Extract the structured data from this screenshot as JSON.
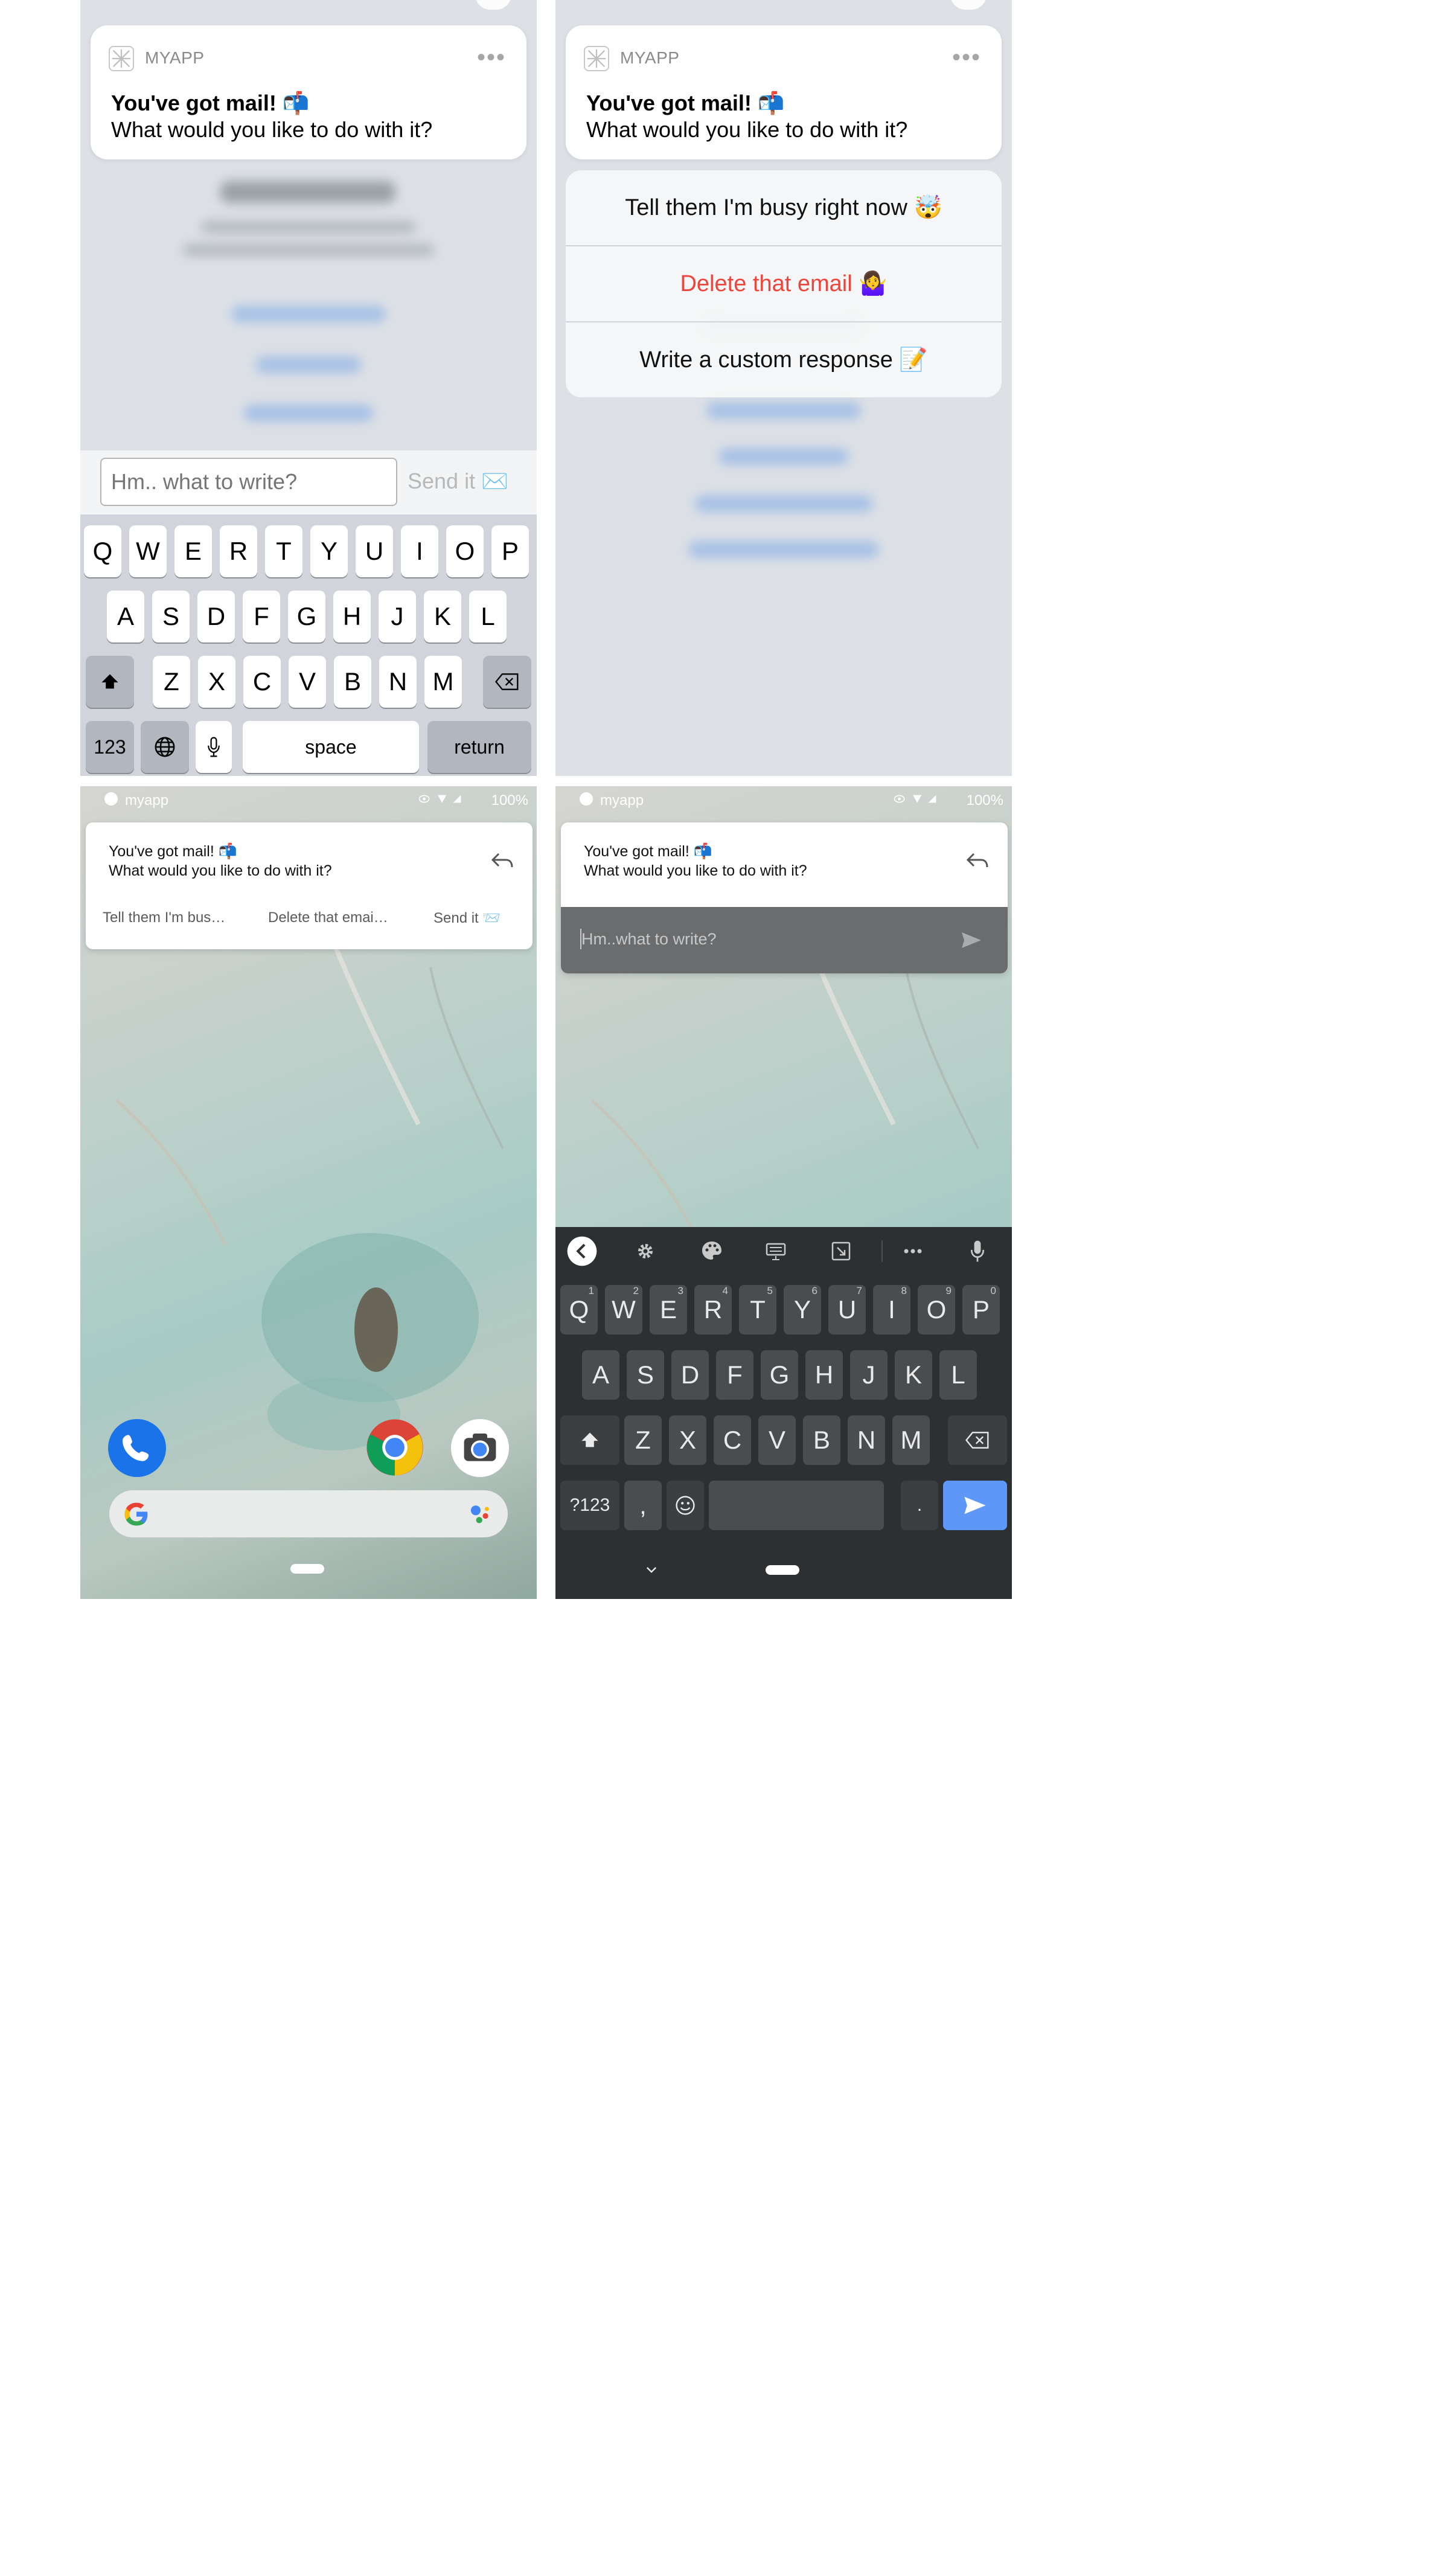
{
  "ios_notification": {
    "app_name": "MYAPP",
    "more": "•••",
    "title": "You've got mail! 📬",
    "body": "What would you like to do with it?"
  },
  "ios_reply": {
    "placeholder": "Hm.. what to write?",
    "send_label": "Send it ✉️"
  },
  "ios_keyboard": {
    "row1": [
      "Q",
      "W",
      "E",
      "R",
      "T",
      "Y",
      "U",
      "I",
      "O",
      "P"
    ],
    "row2": [
      "A",
      "S",
      "D",
      "F",
      "G",
      "H",
      "J",
      "K",
      "L"
    ],
    "row3": [
      "Z",
      "X",
      "C",
      "V",
      "B",
      "N",
      "M"
    ],
    "numbers_label": "123",
    "space_label": "space",
    "return_label": "return"
  },
  "ios_actions": [
    {
      "label": "Tell them I'm busy right now 🤯"
    },
    {
      "label": "Delete that email 🤷‍♀️"
    },
    {
      "label": "Write a custom response 📝"
    }
  ],
  "android_status": {
    "app_name": "myapp",
    "battery": "100%"
  },
  "android_notification": {
    "title": "You've got mail! 📬",
    "body": "What would you like to do with it?",
    "actions": [
      "Tell them I'm bus…",
      "Delete that emai…",
      "Send it 📨"
    ]
  },
  "android_reply": {
    "placeholder": "Hm..what to write?"
  },
  "gboard": {
    "row1": [
      {
        "key": "Q",
        "hint": "1"
      },
      {
        "key": "W",
        "hint": "2"
      },
      {
        "key": "E",
        "hint": "3"
      },
      {
        "key": "R",
        "hint": "4"
      },
      {
        "key": "T",
        "hint": "5"
      },
      {
        "key": "Y",
        "hint": "6"
      },
      {
        "key": "U",
        "hint": "7"
      },
      {
        "key": "I",
        "hint": "8"
      },
      {
        "key": "O",
        "hint": "9"
      },
      {
        "key": "P",
        "hint": "0"
      }
    ],
    "row2": [
      "A",
      "S",
      "D",
      "F",
      "G",
      "H",
      "J",
      "K",
      "L"
    ],
    "row3": [
      "Z",
      "X",
      "C",
      "V",
      "B",
      "N",
      "M"
    ],
    "symbols_label": "?123",
    "comma": ",",
    "period": "."
  },
  "colors": {
    "ios_destructive": "#f0443a",
    "gboard_bg": "#2d3032",
    "gboard_enter": "#5e97f6"
  }
}
